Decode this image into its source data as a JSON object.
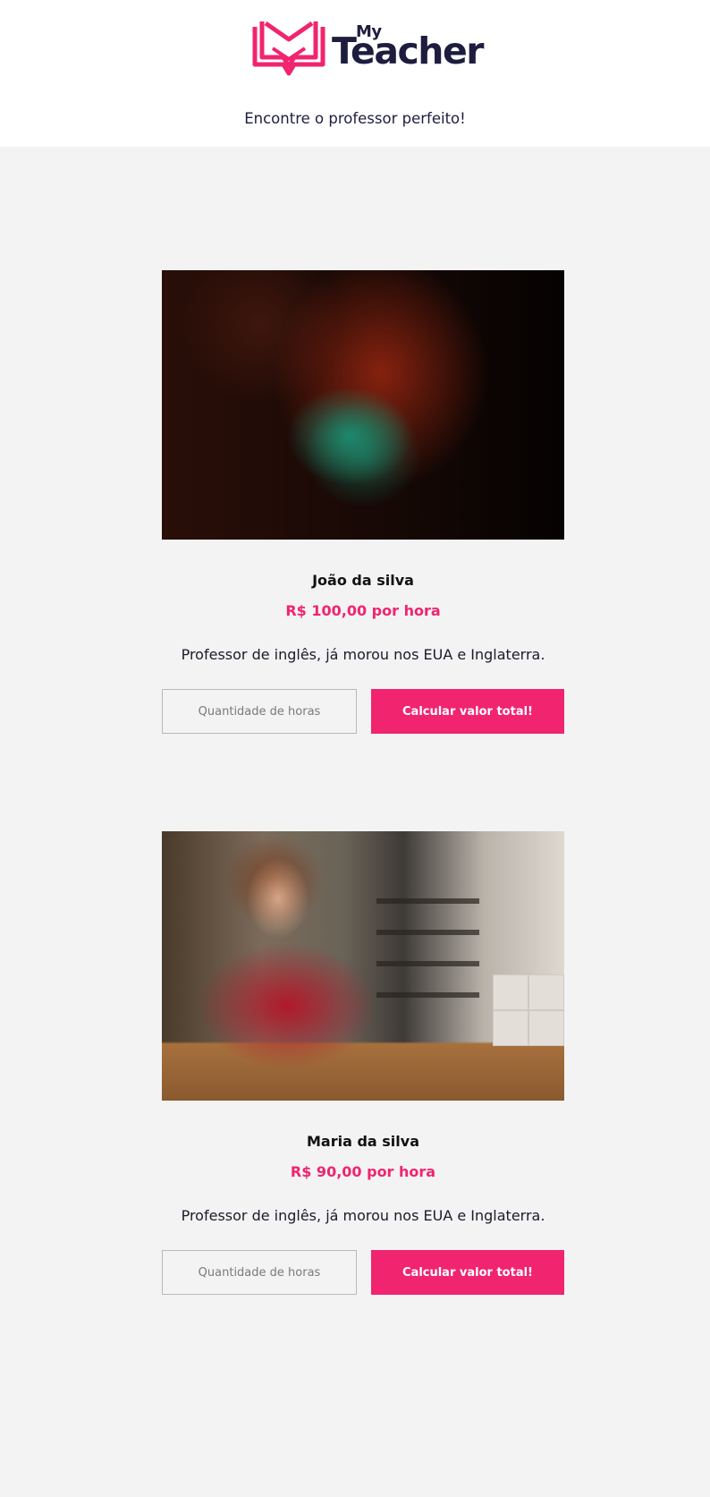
{
  "header": {
    "logo_my": "My",
    "logo_teacher": "Teacher",
    "tagline": "Encontre o professor perfeito!"
  },
  "brand_colors": {
    "accent": "#f0246f",
    "dark": "#1e1d3f",
    "background": "#f3f3f3"
  },
  "teachers": [
    {
      "name": "João da silva",
      "price": "R$ 100,00 por hora",
      "description": "Professor de inglês, já morou nos EUA e Inglaterra.",
      "hours_placeholder": "Quantidade de horas",
      "button_label": "Calcular valor total!"
    },
    {
      "name": "Maria da silva",
      "price": "R$ 90,00 por hora",
      "description": "Professor de inglês, já morou nos EUA e Inglaterra.",
      "hours_placeholder": "Quantidade de horas",
      "button_label": "Calcular valor total!"
    }
  ]
}
